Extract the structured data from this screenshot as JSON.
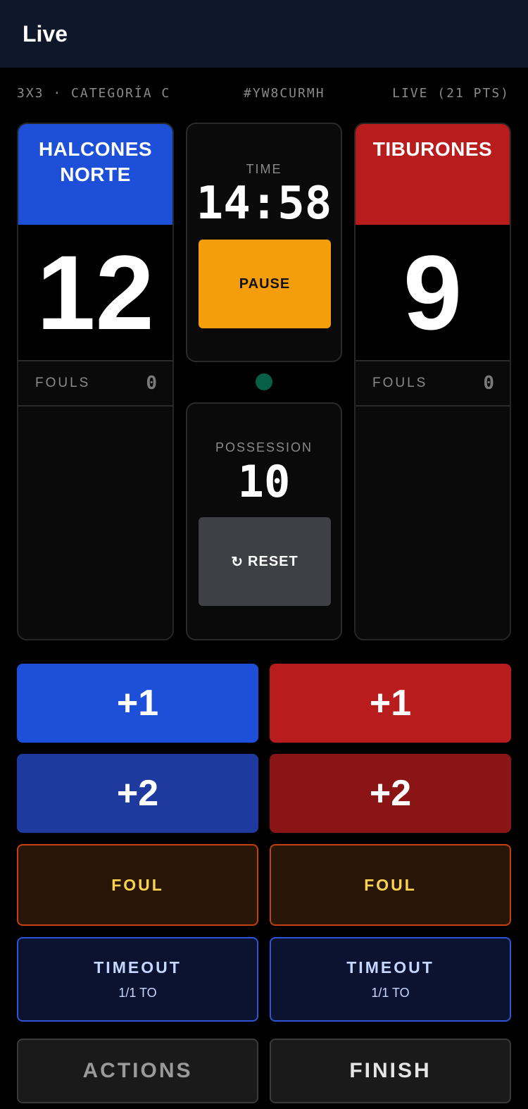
{
  "header": {
    "title": "Live"
  },
  "meta": {
    "category": "3X3 · CATEGORÍA C",
    "code": "#YW8CURMH",
    "status": "LIVE (21 PTS)"
  },
  "teams": {
    "home": {
      "name": "HALCONES NORTE",
      "score": "12",
      "fouls_label": "FOULS",
      "fouls": "0",
      "color": "#1d4fd8"
    },
    "away": {
      "name": "TIBURONES",
      "score": "9",
      "fouls_label": "FOULS",
      "fouls": "0",
      "color": "#b91c1c"
    }
  },
  "timer": {
    "label": "TIME",
    "value": "14:58",
    "pause_label": "PAUSE"
  },
  "possession": {
    "label": "POSSESSION",
    "value": "10",
    "reset_icon": "↻",
    "reset_label": "RESET"
  },
  "controls": {
    "home": {
      "plus1": "+1",
      "plus2": "+2",
      "foul": "FOUL",
      "timeout": "TIMEOUT",
      "timeout_count": "1/1 TO"
    },
    "away": {
      "plus1": "+1",
      "plus2": "+2",
      "foul": "FOUL",
      "timeout": "TIMEOUT",
      "timeout_count": "1/1 TO"
    }
  },
  "footer": {
    "actions_label": "ACTIONS",
    "finish_label": "FINISH"
  }
}
